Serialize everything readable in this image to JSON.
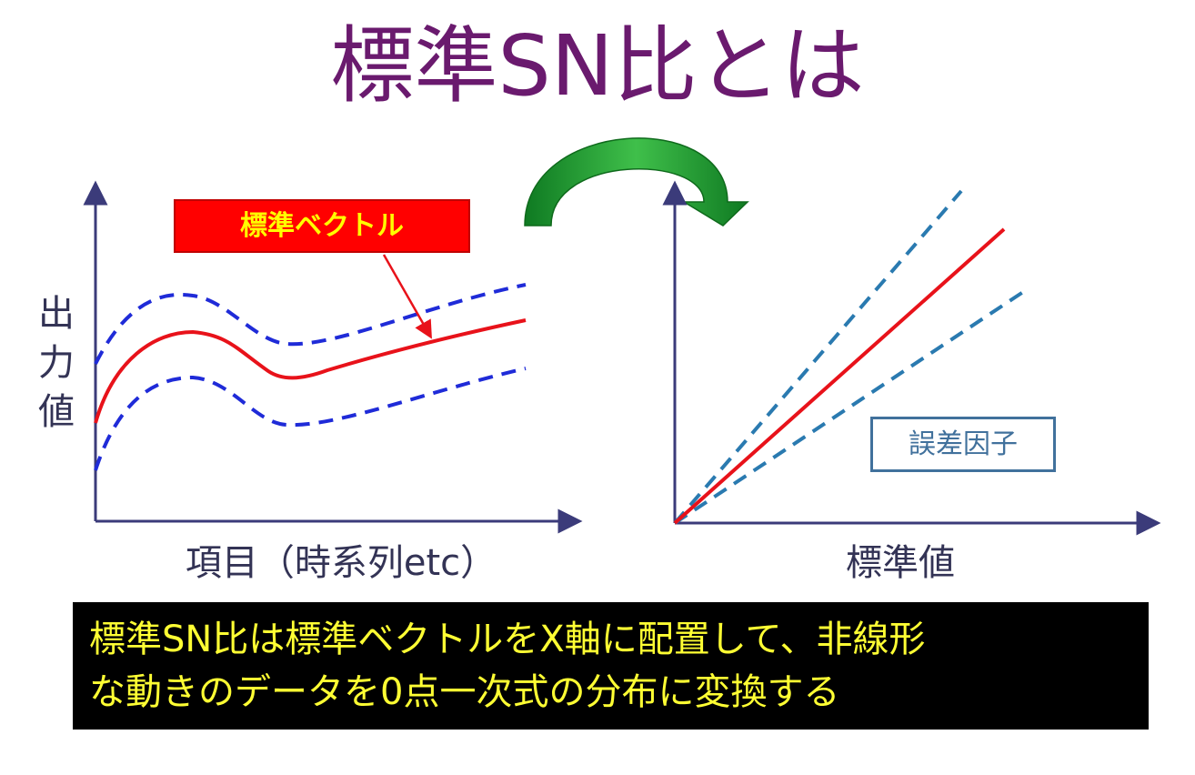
{
  "title": "標準SN比とは",
  "left_chart": {
    "y_axis_label": [
      "出",
      "力",
      "値"
    ],
    "x_axis_label": "項目（時系列etc）",
    "callout_label": "標準ベクトル"
  },
  "right_chart": {
    "x_axis_label": "標準値",
    "callout_label": "誤差因子"
  },
  "caption": {
    "line1": "標準SN比は標準ベクトルをX軸に配置して、非線形",
    "line2": "な動きのデータを0点一次式の分布に変換する"
  },
  "colors": {
    "title": "#6a1a6e",
    "axis": "#3b3b7a",
    "standard_vector_line": "#e8121a",
    "left_band_dashes": "#1f2bd8",
    "right_band_dashes": "#2a7ab0",
    "callout_fill": "#ff0000",
    "callout_text": "#ffff00",
    "arrow_green": "#1f9a32",
    "caption_bg": "#000000",
    "caption_text": "#ffff33"
  }
}
